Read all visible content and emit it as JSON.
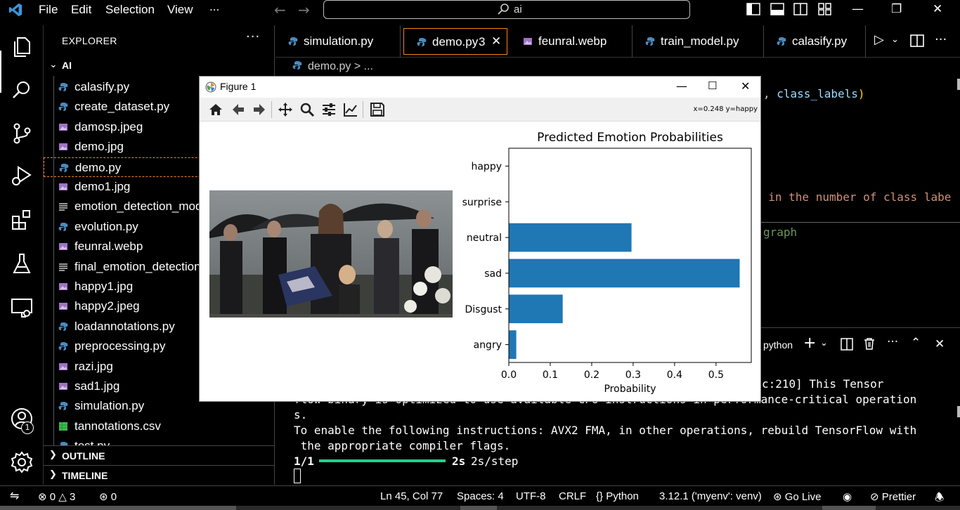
{
  "titlebar": {
    "menu": [
      "File",
      "Edit",
      "Selection",
      "View",
      "..."
    ],
    "search_text": "ai"
  },
  "explorer": {
    "header": "EXPLORER",
    "more": "···",
    "folder": "AI",
    "files": [
      {
        "name": "calasify.py",
        "icon": "python-file-icon"
      },
      {
        "name": "create_dataset.py",
        "icon": "python-file-icon"
      },
      {
        "name": "damosp.jpeg",
        "icon": "image-file-icon"
      },
      {
        "name": "demo.jpg",
        "icon": "image-file-icon"
      },
      {
        "name": "demo.py",
        "icon": "python-file-icon",
        "selected": true
      },
      {
        "name": "demo1.jpg",
        "icon": "image-file-icon"
      },
      {
        "name": "emotion_detection_mod",
        "icon": "text-file-icon"
      },
      {
        "name": "evolution.py",
        "icon": "python-file-icon"
      },
      {
        "name": "feunral.webp",
        "icon": "image-file-icon"
      },
      {
        "name": "final_emotion_detection",
        "icon": "text-file-icon"
      },
      {
        "name": "happy1.jpg",
        "icon": "image-file-icon"
      },
      {
        "name": "happy2.jpeg",
        "icon": "image-file-icon"
      },
      {
        "name": "loadannotations.py",
        "icon": "python-file-icon"
      },
      {
        "name": "preprocessing.py",
        "icon": "python-file-icon"
      },
      {
        "name": "razi.jpg",
        "icon": "image-file-icon"
      },
      {
        "name": "sad1.jpg",
        "icon": "image-file-icon"
      },
      {
        "name": "simulation.py",
        "icon": "python-file-icon"
      },
      {
        "name": "tannotations.csv",
        "icon": "csv-file-icon"
      },
      {
        "name": "test.py",
        "icon": "python-file-icon"
      }
    ],
    "outline": "OUTLINE",
    "timeline": "TIMELINE"
  },
  "activity": {
    "account_badge": "1"
  },
  "tabs": [
    {
      "label": "simulation.py",
      "icon": "python-file-icon"
    },
    {
      "label": "demo.py",
      "icon": "python-file-icon",
      "problems": "3",
      "active": true
    },
    {
      "label": "feunral.webp",
      "icon": "image-file-icon"
    },
    {
      "label": "train_model.py",
      "icon": "python-file-icon"
    },
    {
      "label": "calasify.py",
      "icon": "python-file-icon"
    }
  ],
  "breadcrumb": {
    "file": "demo.py",
    "sep": ">",
    "rest": "..."
  },
  "editor": {
    "line_a_punct": ", ",
    "line_a_var": "class_labels",
    "line_a_close": ")",
    "line_b": "n in the number of class labe",
    "line_c": "graph"
  },
  "panel": {
    "terminal_name": "python",
    "lines": [
      "c:210] This Tensor",
      "flow binary is optimized to use available CPU instructions in performance-critical operation",
      "s.",
      "To enable the following instructions: AVX2 FMA, in other operations, rebuild TensorFlow with",
      " the appropriate compiler flags."
    ],
    "progress_step": "1/1",
    "progress_time": "2s",
    "progress_rate": "2s/step"
  },
  "statusbar": {
    "errors": "0",
    "warnings": "3",
    "ports": "0",
    "position": "Ln 45, Col 77",
    "spaces": "Spaces: 4",
    "encoding": "UTF-8",
    "eol": "CRLF",
    "language": "Python",
    "interpreter": "3.12.1 ('myenv': venv)",
    "golive": "Go Live",
    "prettier": "Prettier"
  },
  "figure": {
    "title": "Figure 1",
    "coords": "x=0.248 y=happy"
  },
  "chart_data": {
    "type": "bar",
    "orientation": "horizontal",
    "title": "Predicted Emotion Probabilities",
    "xlabel": "Probability",
    "ylabel": "",
    "categories": [
      "angry",
      "Disgust",
      "sad",
      "neutral",
      "surprise",
      "happy"
    ],
    "values": [
      0.018,
      0.13,
      0.557,
      0.296,
      0.0,
      0.0
    ],
    "xlim": [
      0,
      0.585
    ],
    "xticks": [
      "0.0",
      "0.1",
      "0.2",
      "0.3",
      "0.4",
      "0.5"
    ],
    "grid": false,
    "bar_color": "#1f77b4"
  },
  "colors": {
    "accent": "#f38518",
    "keyword_var": "#9cdcfe",
    "string": "#ce9178",
    "comment": "#6a9955",
    "progress": "#23d18b"
  }
}
